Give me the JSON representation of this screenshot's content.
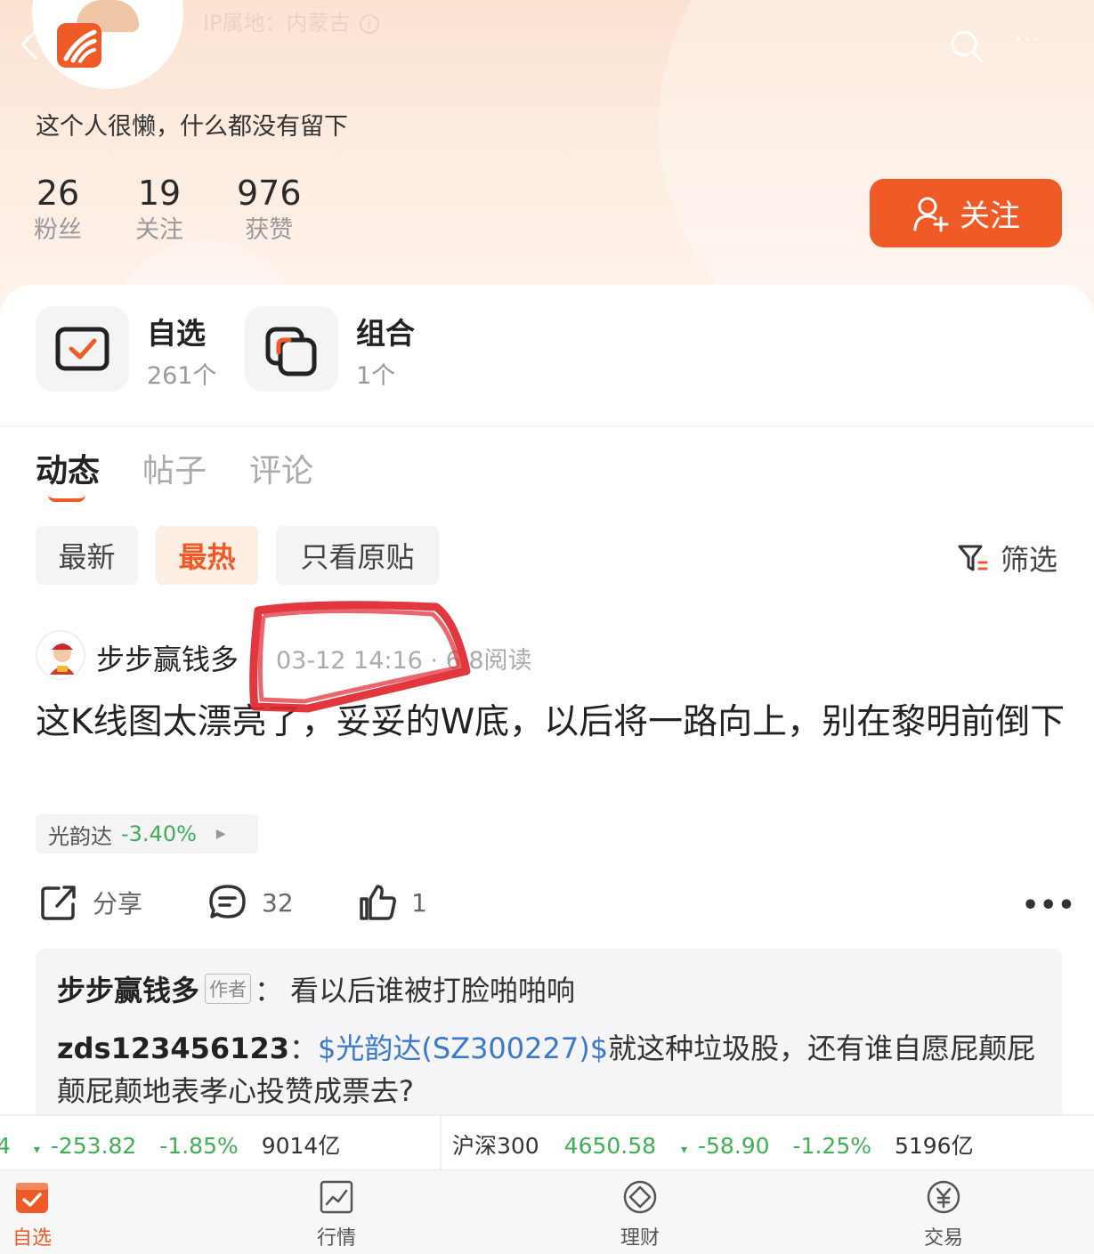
{
  "header": {
    "ip_location": "IP属地：内蒙古",
    "bio": "这个人很懒，什么都没有留下",
    "stats": [
      {
        "value": "26",
        "label": "粉丝"
      },
      {
        "value": "19",
        "label": "关注"
      },
      {
        "value": "976",
        "label": "获赞"
      }
    ],
    "follow_label": "关注",
    "info_glyph": "i",
    "more_glyph": "···"
  },
  "entries": [
    {
      "title": "自选",
      "sub": "261个"
    },
    {
      "title": "组合",
      "sub": "1个"
    }
  ],
  "tabs": [
    "动态",
    "帖子",
    "评论"
  ],
  "filters": [
    "最新",
    "最热",
    "只看原贴"
  ],
  "filter_active_index": 1,
  "screen_label": "筛选",
  "post": {
    "author": "步步赢钱多",
    "meta": "03-12 14:16 · 6 8阅读",
    "text": "这K线图太漂亮了，妥妥的W底，以后将一路向上，别在黎明前倒下",
    "stock_name": "光韵达",
    "stock_change": "-3.40%",
    "share_label": "分享",
    "comment_count": "32",
    "like_count": "1",
    "more": "•••"
  },
  "comments": [
    {
      "author": "步步赢钱多",
      "badge": "作者",
      "sep": "：",
      "text": "看以后谁被打脸啪啪响"
    },
    {
      "author": "zds123456123",
      "sep": "：",
      "link": "$光韵达(SZ300227)$",
      "text": "就这种垃圾股，还有谁自愿屁颠屁颠屁颠地表孝心投赞成票去?"
    }
  ],
  "ticker": {
    "left": {
      "lead": "4",
      "arrow": "▾",
      "change": "-253.82",
      "pct": "-1.85%",
      "amount": "9014亿"
    },
    "right": {
      "name": "沪深300",
      "value": "4650.58",
      "arrow": "▾",
      "change": "-58.90",
      "pct": "-1.25%",
      "amount": "5196亿"
    }
  },
  "bottom_nav": [
    {
      "label": "自选",
      "icon": "watchlist-icon"
    },
    {
      "label": "行情",
      "icon": "market-chart-icon"
    },
    {
      "label": "理财",
      "icon": "wealth-icon"
    },
    {
      "label": "交易",
      "icon": "yuan-trade-icon"
    }
  ],
  "colors": {
    "accent": "#ef5a26",
    "down_green": "#3fae55",
    "link": "#3a78c9",
    "annotation_red": "#e0262e"
  }
}
